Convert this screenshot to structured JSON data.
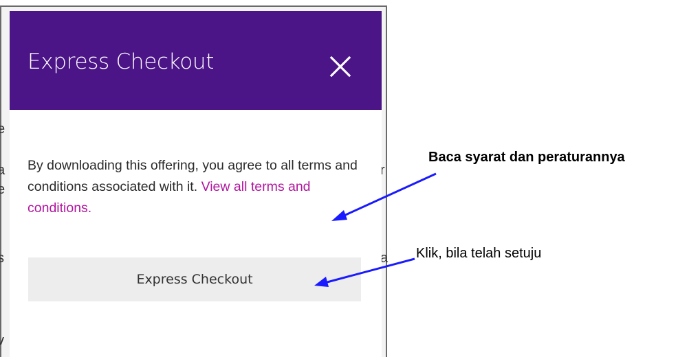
{
  "dialog": {
    "title": "Express Checkout",
    "close_icon": "close-icon",
    "message": "By downloading this offering, you agree to all terms and conditions associated with it.",
    "terms_link": "View all terms and conditions.",
    "checkout_button": "Express Checkout"
  },
  "annotations": {
    "terms_note": "Baca syarat dan peraturannya",
    "checkout_note": "Klik, bila telah setuju"
  },
  "colors": {
    "header": "#4b1487",
    "link": "#b0169e",
    "button_bg": "#ededed",
    "arrow": "#1a1aff"
  }
}
